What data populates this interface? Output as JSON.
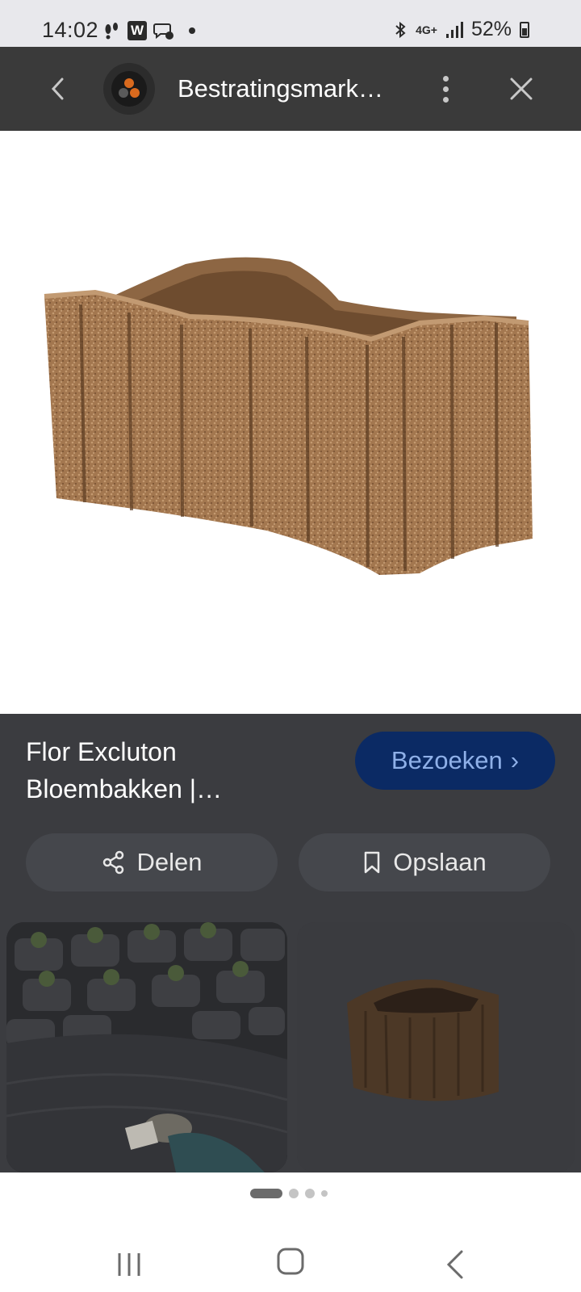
{
  "status_bar": {
    "time": "14:02",
    "network": "4G+",
    "battery": "52%",
    "left_icons": [
      "steps-icon",
      "w-app-icon",
      "messenger-icon",
      "notification-dot"
    ],
    "w_label": "W",
    "right_icons": [
      "bluetooth-icon",
      "network-4g-icon",
      "signal-icon",
      "battery-icon"
    ]
  },
  "app_bar": {
    "site_title": "Bestratingsmark…",
    "icons": [
      "back-icon",
      "site-logo",
      "more-vertical-icon",
      "close-icon"
    ]
  },
  "result": {
    "title": "Flor Excluton Bloembakken |…",
    "visit_label": "Bezoeken",
    "visit_chevron": "›",
    "share_label": "Delen",
    "save_label": "Opslaan"
  },
  "colors": {
    "app_bar": "#3a3a3a",
    "panel": "#3b3c40",
    "visit_button": "#0b2a64",
    "visit_text": "#8fb0e8",
    "planter": "#a3774f"
  },
  "pager": {
    "count": 4,
    "active": 0
  },
  "nav_bar": {
    "icons": [
      "recents-icon",
      "home-icon",
      "back-nav-icon"
    ]
  }
}
